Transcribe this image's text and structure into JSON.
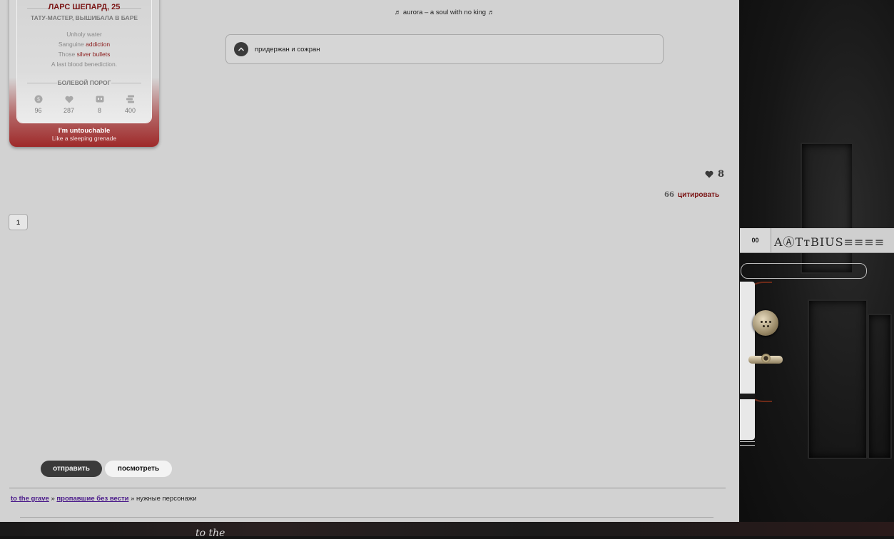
{
  "profile": {
    "name": "ЛАРС ШЕПАРД, 25",
    "role": "ТАТУ-МАСТЕР, ВЫШИБАЛА В БАРЕ",
    "poem": {
      "line1": "Unholy water",
      "line2_prefix": "Sanguine ",
      "line2_accent": "addiction",
      "line3_prefix": "Those ",
      "line3_accent": "silver bullets",
      "line4": "A last blood benediction."
    },
    "threshold_label": "БОЛЕВОЙ ПОРОГ",
    "stats": [
      {
        "icon": "coin-icon",
        "value": "96"
      },
      {
        "icon": "heart-icon",
        "value": "287"
      },
      {
        "icon": "message-icon",
        "value": "8"
      },
      {
        "icon": "stack-icon",
        "value": "400"
      }
    ],
    "footer_line1": "I'm untouchable",
    "footer_line2": "Like a sleeping grenade"
  },
  "post": {
    "song": "♬ aurora – a soul with no king ♬",
    "spoiler_text": "придержан и сожран",
    "likes": "8",
    "quote_mark": "66",
    "quote_label": "цитировать"
  },
  "pagination": {
    "current": "1"
  },
  "form": {
    "submit_label": "отправить",
    "preview_label": "посмотреть"
  },
  "breadcrumbs": {
    "item1": "to the grave",
    "sep": " » ",
    "item2": "пропавшие без вести",
    "item3": "нужные персонажи"
  },
  "editor": {
    "counter": "00",
    "tools": "AⒶTтBIUS≡≡≡≡"
  },
  "footer": {
    "motto": "to the"
  },
  "colors": {
    "accent": "#7a1414",
    "panel": "#d2d2d2",
    "dark_button": "#3a3a3a"
  }
}
